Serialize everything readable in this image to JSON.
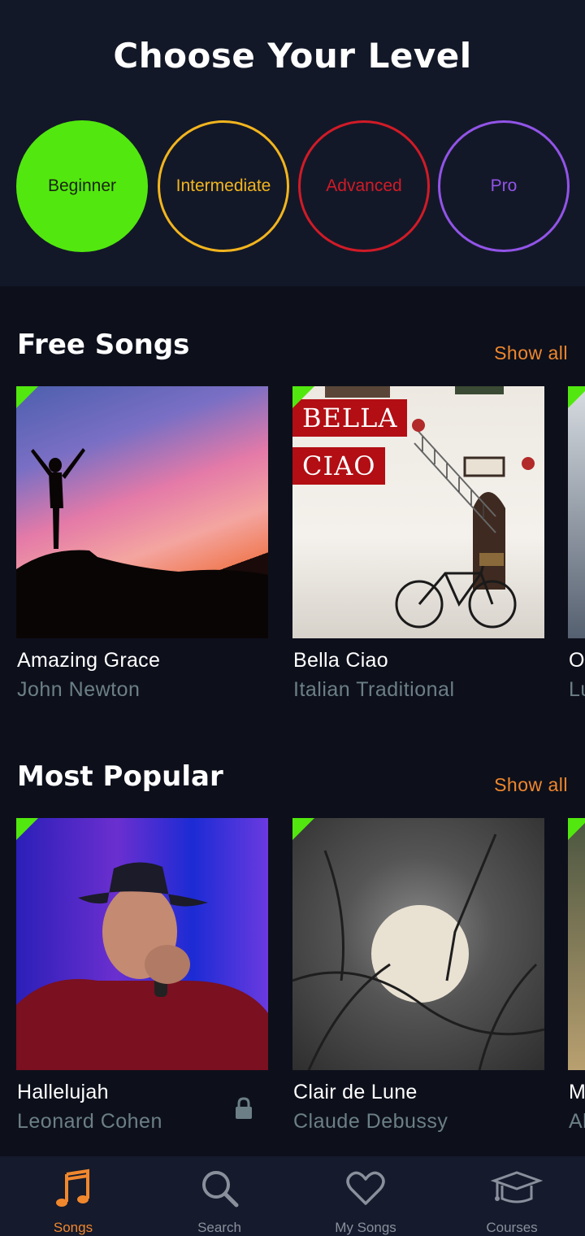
{
  "header": {
    "title": "Choose Your Level"
  },
  "levels": [
    {
      "label": "Beginner",
      "color": "#52e80f",
      "selected": true
    },
    {
      "label": "Intermediate",
      "color": "#f2b51e",
      "selected": false
    },
    {
      "label": "Advanced",
      "color": "#d11b27",
      "selected": false
    },
    {
      "label": "Pro",
      "color": "#9254e8",
      "selected": false
    }
  ],
  "free_songs": {
    "title": "Free Songs",
    "show_all": "Show all",
    "items": [
      {
        "name": "Amazing Grace",
        "artist": "John Newton"
      },
      {
        "name": "Bella Ciao",
        "artist": "Italian Traditional",
        "cover_text": [
          "BELLA",
          "CIAO"
        ]
      },
      {
        "name": "Od",
        "artist": "Lu"
      }
    ]
  },
  "most_popular": {
    "title": "Most Popular",
    "show_all": "Show all",
    "items": [
      {
        "name": "Hallelujah",
        "artist": "Leonard Cohen",
        "locked": true
      },
      {
        "name": "Clair de Lune",
        "artist": "Claude Debussy"
      },
      {
        "name": "M",
        "artist": "Al"
      }
    ]
  },
  "nav": {
    "items": [
      {
        "label": "Songs",
        "icon": "music-note-icon",
        "active": true
      },
      {
        "label": "Search",
        "icon": "search-icon",
        "active": false
      },
      {
        "label": "My Songs",
        "icon": "heart-icon",
        "active": false
      },
      {
        "label": "Courses",
        "icon": "graduation-cap-icon",
        "active": false
      }
    ]
  },
  "colors": {
    "accent": "#f0872d",
    "background": "#0d101b",
    "free_badge": "#52e80f"
  }
}
